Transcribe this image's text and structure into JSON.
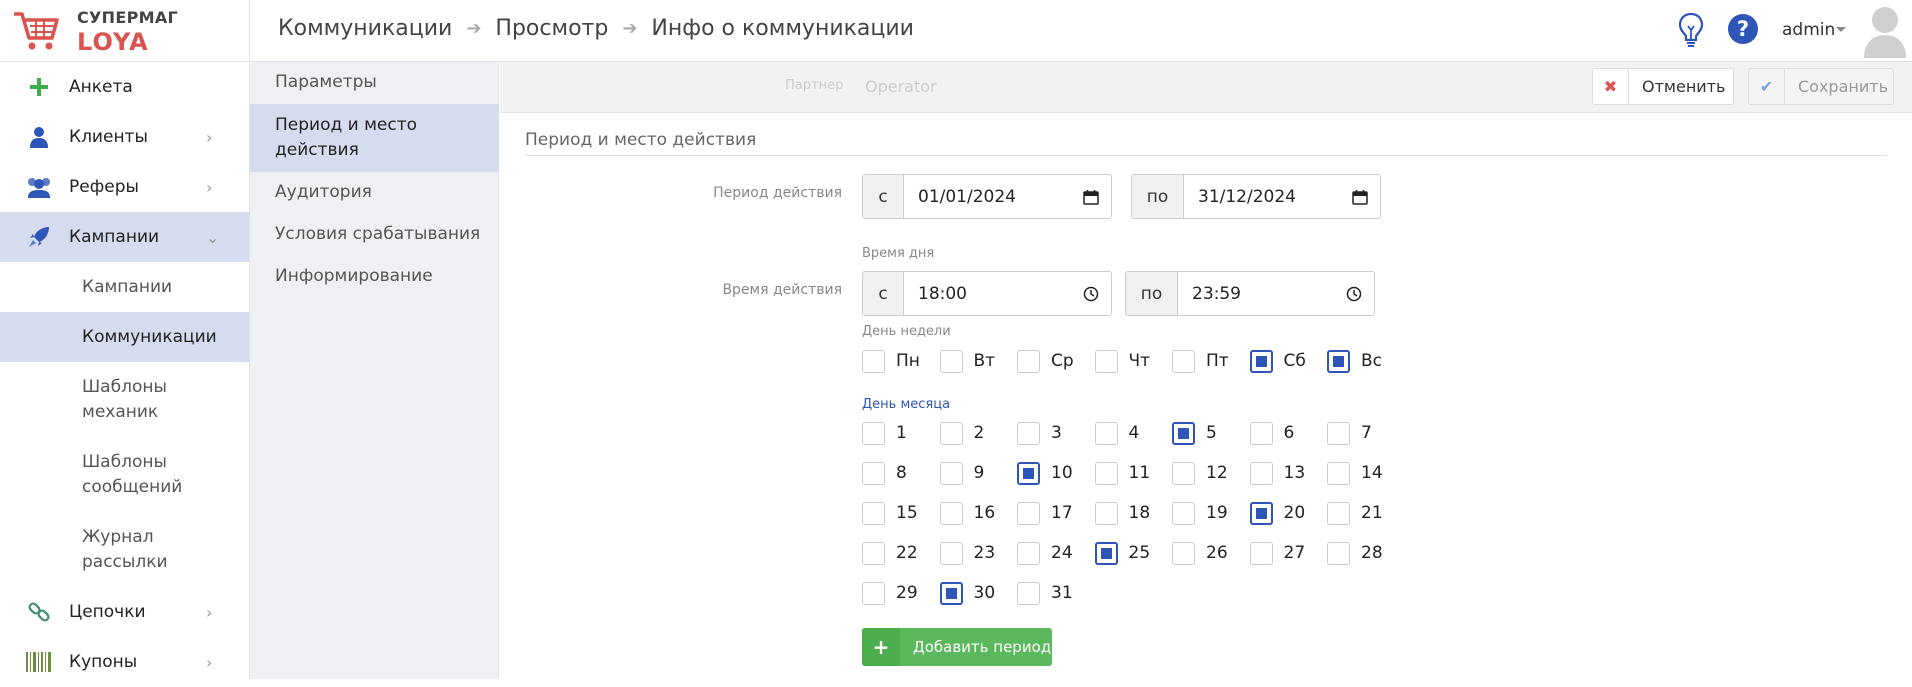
{
  "app": {
    "logo_top": "СУПЕРМАГ",
    "logo_bottom": "LOYA",
    "user": "admin",
    "help_symbol": "?",
    "icons": {
      "logo": "shopping-cart-icon",
      "tip": "lightbulb-icon",
      "help": "question-circle-icon",
      "avatar": "user-avatar-icon"
    }
  },
  "breadcrumb": [
    "Коммуникации",
    "Просмотр",
    "Инфо о коммуникации"
  ],
  "breadcrumb_separator": "➔",
  "sidebar": {
    "items": [
      {
        "label": "Анкета",
        "icon": "plus-icon",
        "color": "#3fae49"
      },
      {
        "label": "Клиенты",
        "icon": "user-icon",
        "chevron": "›"
      },
      {
        "label": "Реферы",
        "icon": "users-icon",
        "chevron": "›"
      },
      {
        "label": "Кампании",
        "icon": "rocket-icon",
        "chevron": "⌄",
        "active": true
      },
      {
        "label": "Цепочки",
        "icon": "link-icon",
        "chevron": "›"
      },
      {
        "label": "Купоны",
        "icon": "barcode-icon",
        "chevron": "›"
      }
    ],
    "sub": [
      {
        "label": "Кампании"
      },
      {
        "label": "Коммуникации",
        "active": true
      },
      {
        "label": "Шаблоны механик"
      },
      {
        "label": "Шаблоны сообщений"
      },
      {
        "label": "Журнал рассылки"
      }
    ]
  },
  "subnav": [
    {
      "label": "Параметры"
    },
    {
      "label": "Период и место действия",
      "active": true
    },
    {
      "label": "Аудитория"
    },
    {
      "label": "Условия срабатывания"
    },
    {
      "label": "Информирование"
    }
  ],
  "toolbar": {
    "partner_label": "Партнер",
    "partner_value": "Operator",
    "cancel_icon": "✖",
    "cancel_label": "Отменить",
    "save_icon": "✔",
    "save_label": "Сохранить"
  },
  "section": {
    "title": "Период и место действия",
    "period_label": "Период действия",
    "period_from_prefix": "с",
    "period_from": "01/01/2024",
    "period_to_prefix": "по",
    "period_to": "31/12/2024",
    "time_label": "Время действия",
    "time_of_day_label": "Время дня",
    "time_from_prefix": "с",
    "time_from": "18:00",
    "time_to_prefix": "по",
    "time_to": "23:59",
    "weekday_label": "День недели",
    "weekdays": [
      {
        "label": "Пн",
        "checked": false
      },
      {
        "label": "Вт",
        "checked": false
      },
      {
        "label": "Ср",
        "checked": false
      },
      {
        "label": "Чт",
        "checked": false
      },
      {
        "label": "Пт",
        "checked": false
      },
      {
        "label": "Сб",
        "checked": true
      },
      {
        "label": "Вс",
        "checked": true
      }
    ],
    "monthday_label": "День месяца",
    "monthdays_checked": [
      5,
      10,
      20,
      25,
      30
    ],
    "add_period_label": "Добавить период",
    "add_period_icon": "+"
  },
  "colors": {
    "accent": "#2d56b8",
    "active_bg": "#d6dcef",
    "success": "#5cb85c",
    "danger": "#d9534f"
  }
}
